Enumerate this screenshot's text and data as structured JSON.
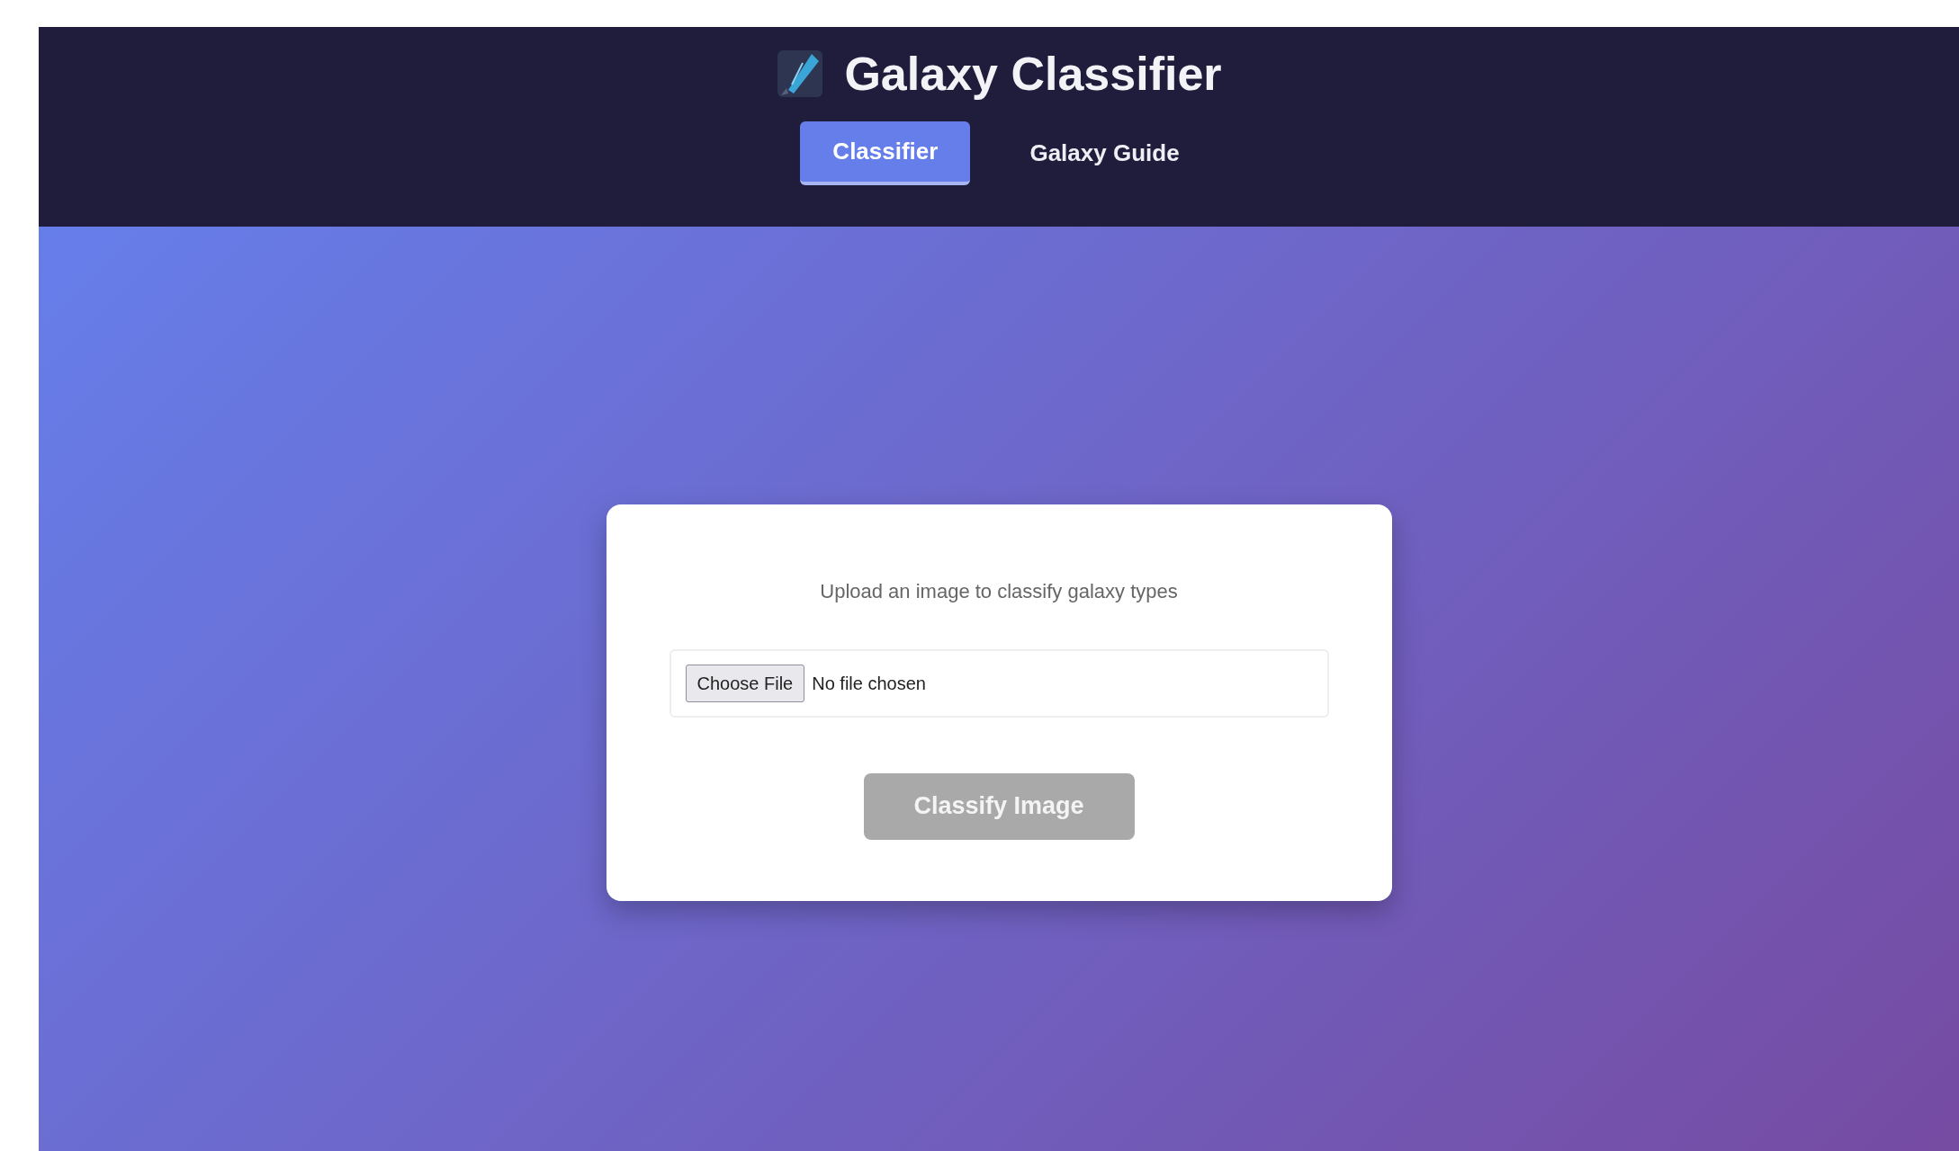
{
  "header": {
    "title": "Galaxy Classifier"
  },
  "tabs": [
    {
      "label": "Classifier",
      "selected": true
    },
    {
      "label": "Galaxy Guide",
      "selected": false
    }
  ],
  "upload_card": {
    "instruction": "Upload an image to classify galaxy types",
    "file_input": {
      "button": "Choose File",
      "status": "No file chosen"
    },
    "classify_button": {
      "label": "Classify Image",
      "disabled": true
    }
  }
}
